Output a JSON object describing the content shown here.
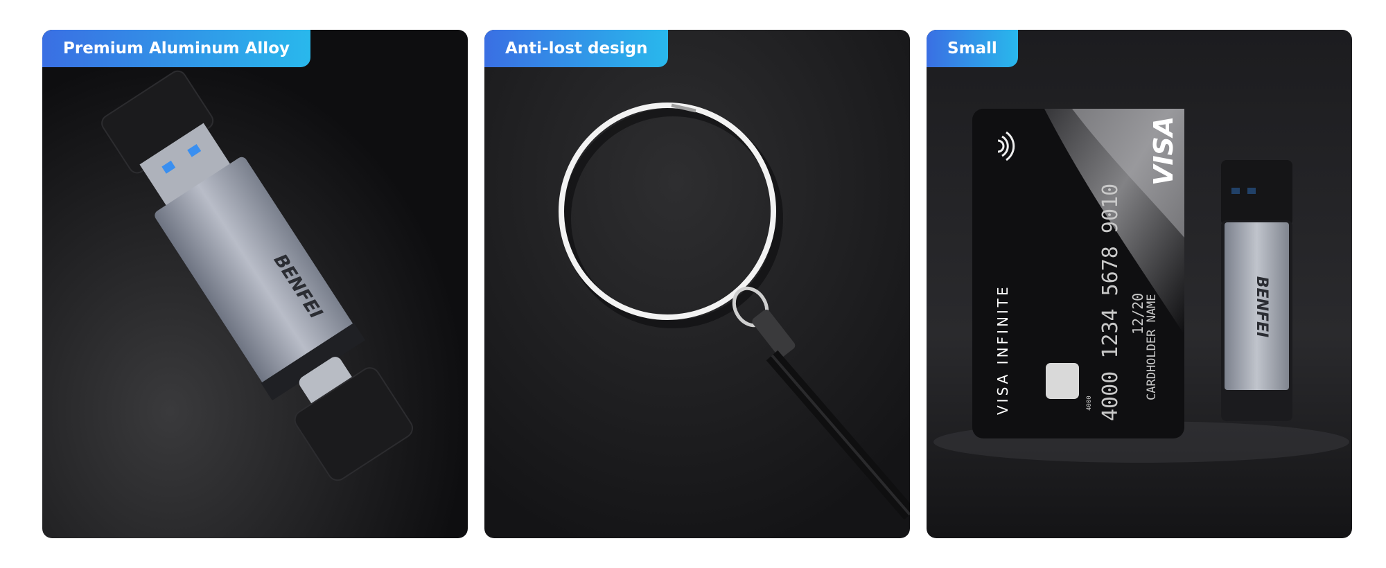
{
  "panels": [
    {
      "title": "Premium Aluminum Alloy",
      "brand": "BENFEI"
    },
    {
      "title": "Anti-lost design"
    },
    {
      "title": "Small",
      "brand": "BENFEI",
      "card": {
        "number": "4000 1234 5678 9010",
        "small_number": "4000",
        "expiry": "12/20",
        "holder": "CARDHOLDER NAME",
        "product": "VISA INFINITE",
        "network": "VISA"
      }
    }
  ],
  "colors": {
    "tag_start": "#3a6fe3",
    "tag_end": "#29b8ec",
    "background": "#1a1a1c"
  }
}
